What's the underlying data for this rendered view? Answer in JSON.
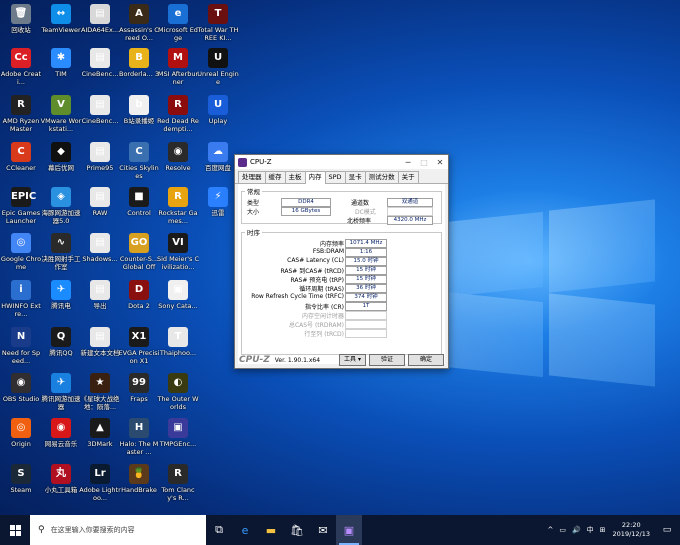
{
  "desktop": {
    "icons": [
      {
        "label": "回收站",
        "color": "#6e7b8b",
        "glyph": "🗑"
      },
      {
        "label": "TeamViewer",
        "color": "#0e8ee9",
        "glyph": "↔"
      },
      {
        "label": "AIDA64Ex...",
        "color": "#d8d8d8",
        "glyph": "▤"
      },
      {
        "label": "Assassin's Creed O...",
        "color": "#3a2a18",
        "glyph": "A"
      },
      {
        "label": "Microsoft Edge",
        "color": "#1a6fd4",
        "glyph": "e"
      },
      {
        "label": "Total War THREE KI...",
        "color": "#6b1010",
        "glyph": "T"
      },
      {
        "label": "Adobe Creati...",
        "color": "#da1f26",
        "glyph": "Cc"
      },
      {
        "label": "TIM",
        "color": "#2b8cff",
        "glyph": "✱"
      },
      {
        "label": "CineBenc...",
        "color": "#e8e8e8",
        "glyph": "▤"
      },
      {
        "label": "Borderla... 3",
        "color": "#e8b21a",
        "glyph": "B"
      },
      {
        "label": "MSI Afterburner",
        "color": "#b01010",
        "glyph": "M"
      },
      {
        "label": "Unreal Engine",
        "color": "#111111",
        "glyph": "U"
      },
      {
        "label": "AMD Ryzen Master",
        "color": "#222222",
        "glyph": "R"
      },
      {
        "label": "VMware Workstati...",
        "color": "#5f8d2c",
        "glyph": "V"
      },
      {
        "label": "CineBenc...",
        "color": "#e8e8e8",
        "glyph": "▤"
      },
      {
        "label": "B站录播姬",
        "color": "#f0f0f0",
        "glyph": "b"
      },
      {
        "label": "Red Dead Redempti...",
        "color": "#8a0c0c",
        "glyph": "R"
      },
      {
        "label": "Uplay",
        "color": "#1a5dd8",
        "glyph": "U"
      },
      {
        "label": "CCleaner",
        "color": "#d93a1c",
        "glyph": "C"
      },
      {
        "label": "幕后优网",
        "color": "#101010",
        "glyph": "◆"
      },
      {
        "label": "Prime95",
        "color": "#e8e8e8",
        "glyph": "▤"
      },
      {
        "label": "Cities Skylines",
        "color": "#3a6fb0",
        "glyph": "C"
      },
      {
        "label": "Resolve",
        "color": "#2a2a2a",
        "glyph": "◉"
      },
      {
        "label": "百度网盘",
        "color": "#3a7cf0",
        "glyph": "☁"
      },
      {
        "label": "Epic Games Launcher",
        "color": "#1a1a1a",
        "glyph": "EPIC"
      },
      {
        "label": "海豚网游加速器5.0",
        "color": "#2a90e0",
        "glyph": "◈"
      },
      {
        "label": "RAW",
        "color": "#e8e8e8",
        "glyph": "▤"
      },
      {
        "label": "Control",
        "color": "#1a1a1a",
        "glyph": "■"
      },
      {
        "label": "Rockstar Games...",
        "color": "#e8a410",
        "glyph": "R"
      },
      {
        "label": "迅雷",
        "color": "#2a80ff",
        "glyph": "⚡"
      },
      {
        "label": "Google Chrome",
        "color": "#4285f4",
        "glyph": "◎"
      },
      {
        "label": "决胜网射手工作室",
        "color": "#2a2a2a",
        "glyph": "∿"
      },
      {
        "label": "Shadows...",
        "color": "#e8e8e8",
        "glyph": "▤"
      },
      {
        "label": "Counter-S... Global Offe...",
        "color": "#d8a020",
        "glyph": "GO"
      },
      {
        "label": "Sid Meier's Civilizatio...",
        "color": "#1a1a1a",
        "glyph": "VI"
      },
      {
        "label": "",
        "color": "",
        "glyph": ""
      },
      {
        "label": "HWINFO Extre...",
        "color": "#2a6fd0",
        "glyph": "i"
      },
      {
        "label": "腾讯电",
        "color": "#1a8cff",
        "glyph": "✈"
      },
      {
        "label": "导出",
        "color": "#e8e8e8",
        "glyph": "▤"
      },
      {
        "label": "Dota 2",
        "color": "#8a1010",
        "glyph": "D"
      },
      {
        "label": "Sony Cata...",
        "color": "#f0f0f0",
        "glyph": "▣"
      },
      {
        "label": "",
        "color": "",
        "glyph": ""
      },
      {
        "label": "Need for Speed...",
        "color": "#1a3a8a",
        "glyph": "N"
      },
      {
        "label": "腾讯QQ",
        "color": "#1a1a1a",
        "glyph": "Q"
      },
      {
        "label": "新建文本文档",
        "color": "#e8e8e8",
        "glyph": "▤"
      },
      {
        "label": "EVGA Precision X1",
        "color": "#1a1a1a",
        "glyph": "X1"
      },
      {
        "label": "Thaiphoo...",
        "color": "#e8e8e8",
        "glyph": "T"
      },
      {
        "label": "",
        "color": "",
        "glyph": ""
      },
      {
        "label": "OBS Studio",
        "color": "#302e31",
        "glyph": "◉"
      },
      {
        "label": "腾讯网游加速器",
        "color": "#1a80e0",
        "glyph": "✈"
      },
      {
        "label": "《星球大战绝地：陨落...",
        "color": "#3a2010",
        "glyph": "★"
      },
      {
        "label": "Fraps",
        "color": "#2a2a2a",
        "glyph": "99"
      },
      {
        "label": "The Outer Worlds",
        "color": "#3a3a10",
        "glyph": "◐"
      },
      {
        "label": "",
        "color": "",
        "glyph": ""
      },
      {
        "label": "Origin",
        "color": "#f06010",
        "glyph": "◎"
      },
      {
        "label": "网易云音乐",
        "color": "#d81818",
        "glyph": "◉"
      },
      {
        "label": "3DMark",
        "color": "#1a1a1a",
        "glyph": "▲"
      },
      {
        "label": "Halo: The Master ...",
        "color": "#2a4a70",
        "glyph": "H"
      },
      {
        "label": "TMPGEnc...",
        "color": "#3a3a9a",
        "glyph": "▣"
      },
      {
        "label": "",
        "color": "",
        "glyph": ""
      },
      {
        "label": "Steam",
        "color": "#1b2838",
        "glyph": "S"
      },
      {
        "label": "小丸工具箱",
        "color": "#b01020",
        "glyph": "丸"
      },
      {
        "label": "Adobe Lightroo...",
        "color": "#0a1a30",
        "glyph": "Lr"
      },
      {
        "label": "HandBrake",
        "color": "#5a3a1a",
        "glyph": "🍍"
      },
      {
        "label": "Tom Clancy's R...",
        "color": "#2a2a2a",
        "glyph": "R"
      },
      {
        "label": "",
        "color": "",
        "glyph": ""
      }
    ]
  },
  "cpuz": {
    "title": "CPU-Z",
    "tabs": [
      "处理器",
      "缓存",
      "主板",
      "内存",
      "SPD",
      "显卡",
      "测试分数",
      "关于"
    ],
    "active_tab": 3,
    "general": {
      "legend": "常规",
      "type_label": "类型",
      "type_value": "DDR4",
      "size_label": "大小",
      "size_value": "16 GBytes",
      "channel_label": "通道数",
      "channel_value": "双通道",
      "dc_label": "DC模式",
      "dc_value": "",
      "nb_label": "北桥频率",
      "nb_value": "4320.0 MHz"
    },
    "timings": {
      "legend": "时序",
      "rows": [
        {
          "label": "内存频率",
          "value": "1071.4 MHz",
          "dim": false
        },
        {
          "label": "FSB:DRAM",
          "value": "1:16",
          "dim": false
        },
        {
          "label": "CAS# Latency (CL)",
          "value": "15.0 时钟",
          "dim": false
        },
        {
          "label": "RAS# 到CAS# (tRCD)",
          "value": "15 时钟",
          "dim": false
        },
        {
          "label": "RAS# 预充电 (tRP)",
          "value": "15 时钟",
          "dim": false
        },
        {
          "label": "循环周期 (tRAS)",
          "value": "36 时钟",
          "dim": false
        },
        {
          "label": "Row Refresh Cycle Time (tRFC)",
          "value": "374 时钟",
          "dim": false
        },
        {
          "label": "指令比率 (CR)",
          "value": "1T",
          "dim": false
        },
        {
          "label": "内存空闲计时器",
          "value": "",
          "dim": true
        },
        {
          "label": "总CAS号 (tRDRAM)",
          "value": "",
          "dim": true
        },
        {
          "label": "行至列 (tRCD)",
          "value": "",
          "dim": true
        }
      ]
    },
    "status": {
      "brand": "CPU-Z",
      "version": "Ver. 1.90.1.x64",
      "tools": "工具",
      "validate": "验证",
      "ok": "确定"
    }
  },
  "taskbar": {
    "search_placeholder": "在这里输入你要搜索的内容",
    "ime": "中",
    "time": "22:20",
    "date": "2019/12/13"
  }
}
